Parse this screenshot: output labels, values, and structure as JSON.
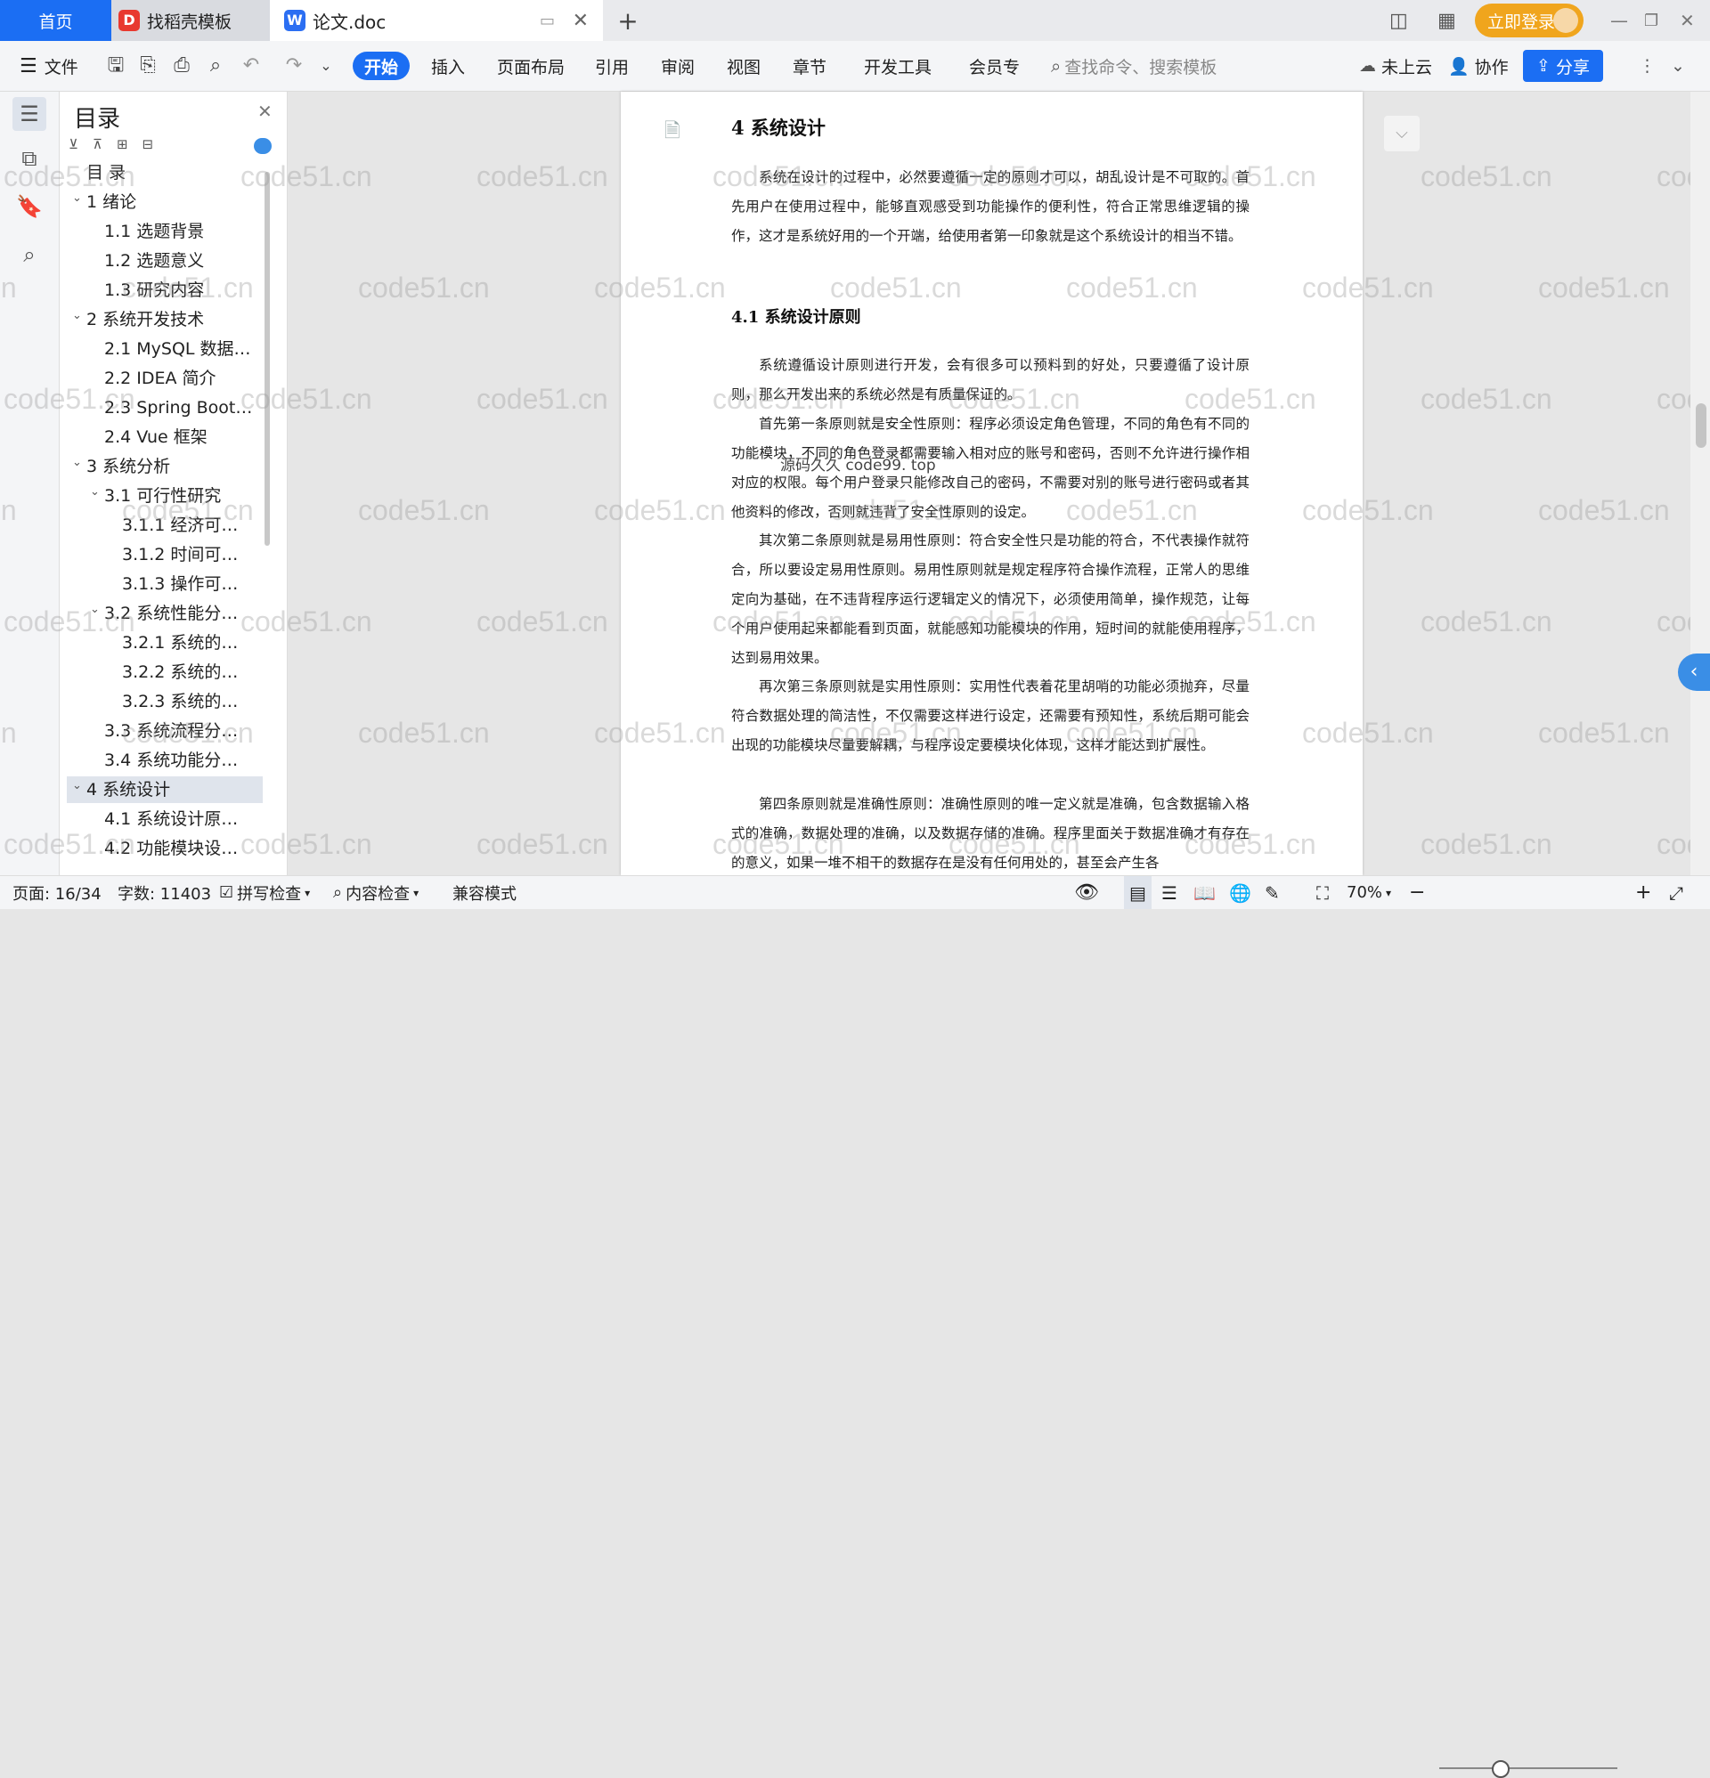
{
  "tabs": {
    "home": "首页",
    "template": "找稻壳模板",
    "doc": "论文.doc",
    "new_tab": "+"
  },
  "header_right": {
    "login": "立即登录"
  },
  "toolbar": {
    "file": "文件",
    "menus": [
      "开始",
      "插入",
      "页面布局",
      "引用",
      "审阅",
      "视图",
      "章节",
      "开发工具",
      "会员专"
    ],
    "search_placeholder": "查找命令、搜索模板",
    "cloud": "未上云",
    "collab": "协作",
    "share": "分享"
  },
  "toc": {
    "title": "目录",
    "items": [
      {
        "label": "目  录",
        "level": 0
      },
      {
        "label": "1  绪论",
        "level": 1,
        "caret": true
      },
      {
        "label": "1.1  选题背景",
        "level": 2
      },
      {
        "label": "1.2  选题意义",
        "level": 2
      },
      {
        "label": "1.3  研究内容",
        "level": 2
      },
      {
        "label": "2  系统开发技术",
        "level": 1,
        "caret": true
      },
      {
        "label": "2.1 MySQL 数据…",
        "level": 2
      },
      {
        "label": "2.2 IDEA 简介",
        "level": 2
      },
      {
        "label": "2.3 Spring Boot …",
        "level": 2
      },
      {
        "label": "2.4 Vue 框架",
        "level": 2
      },
      {
        "label": "3  系统分析",
        "level": 1,
        "caret": true
      },
      {
        "label": "3.1  可行性研究",
        "level": 2,
        "caret": true
      },
      {
        "label": "3.1.1  经济可…",
        "level": 3
      },
      {
        "label": "3.1.2  时间可…",
        "level": 3
      },
      {
        "label": "3.1.3  操作可…",
        "level": 3
      },
      {
        "label": "3.2  系统性能分…",
        "level": 2,
        "caret": true
      },
      {
        "label": "3.2.1  系统的…",
        "level": 3
      },
      {
        "label": "3.2.2  系统的…",
        "level": 3
      },
      {
        "label": "3.2.3  系统的…",
        "level": 3
      },
      {
        "label": "3.3  系统流程分…",
        "level": 2
      },
      {
        "label": "3.4  系统功能分…",
        "level": 2
      },
      {
        "label": "4  系统设计",
        "level": 1,
        "caret": true,
        "selected": true
      },
      {
        "label": "4.1  系统设计原…",
        "level": 2
      },
      {
        "label": "4.2  功能模块设…",
        "level": 2
      }
    ]
  },
  "document": {
    "h1": "4  系统设计",
    "p1": "系统在设计的过程中，必然要遵循一定的原则才可以，胡乱设计是不可取的。首先用户在使用过程中，能够直观感受到功能操作的便利性，符合正常思维逻辑的操作，这才是系统好用的一个开端，给使用者第一印象就是这个系统设计的相当不错。",
    "h2": "4.1  系统设计原则",
    "p2": "系统遵循设计原则进行开发，会有很多可以预料到的好处，只要遵循了设计原则，那么开发出来的系统必然是有质量保证的。",
    "p3": "首先第一条原则就是安全性原则：程序必须设定角色管理，不同的角色有不同的功能模块，不同的角色登录都需要输入相对应的账号和密码，否则不允许进行操作相对应的权限。每个用户登录只能修改自己的密码，不需要对别的账号进行密码或者其他资料的修改，否则就违背了安全性原则的设定。",
    "p4": "其次第二条原则就是易用性原则：符合安全性只是功能的符合，不代表操作就符合，所以要设定易用性原则。易用性原则就是规定程序符合操作流程，正常人的思维定向为基础，在不违背程序运行逻辑定义的情况下，必须使用简单，操作规范，让每个用户使用起来都能看到页面，就能感知功能模块的作用，短时间的就能使用程序，达到易用效果。",
    "p5": "再次第三条原则就是实用性原则：实用性代表着花里胡哨的功能必须抛弃，尽量符合数据处理的简洁性，不仅需要这样进行设定，还需要有预知性，系统后期可能会出现的功能模块尽量要解耦，与程序设定要模块化体现，这样才能达到扩展性。",
    "p6": "第四条原则就是准确性原则：准确性原则的唯一定义就是准确，包含数据输入格式的准确，数据处理的准确，以及数据存储的准确。程序里面关于数据准确才有存在的意义，如果一堆不相干的数据存在是没有任何用处的，甚至会产生各",
    "overlay": "源码久久 code99. top",
    "watermark": "code51.cn"
  },
  "status": {
    "page": "页面: 16/34",
    "words": "字数: 11403",
    "spell": "拼写检查",
    "content": "内容检查",
    "compat": "兼容模式",
    "zoom": "70%"
  }
}
